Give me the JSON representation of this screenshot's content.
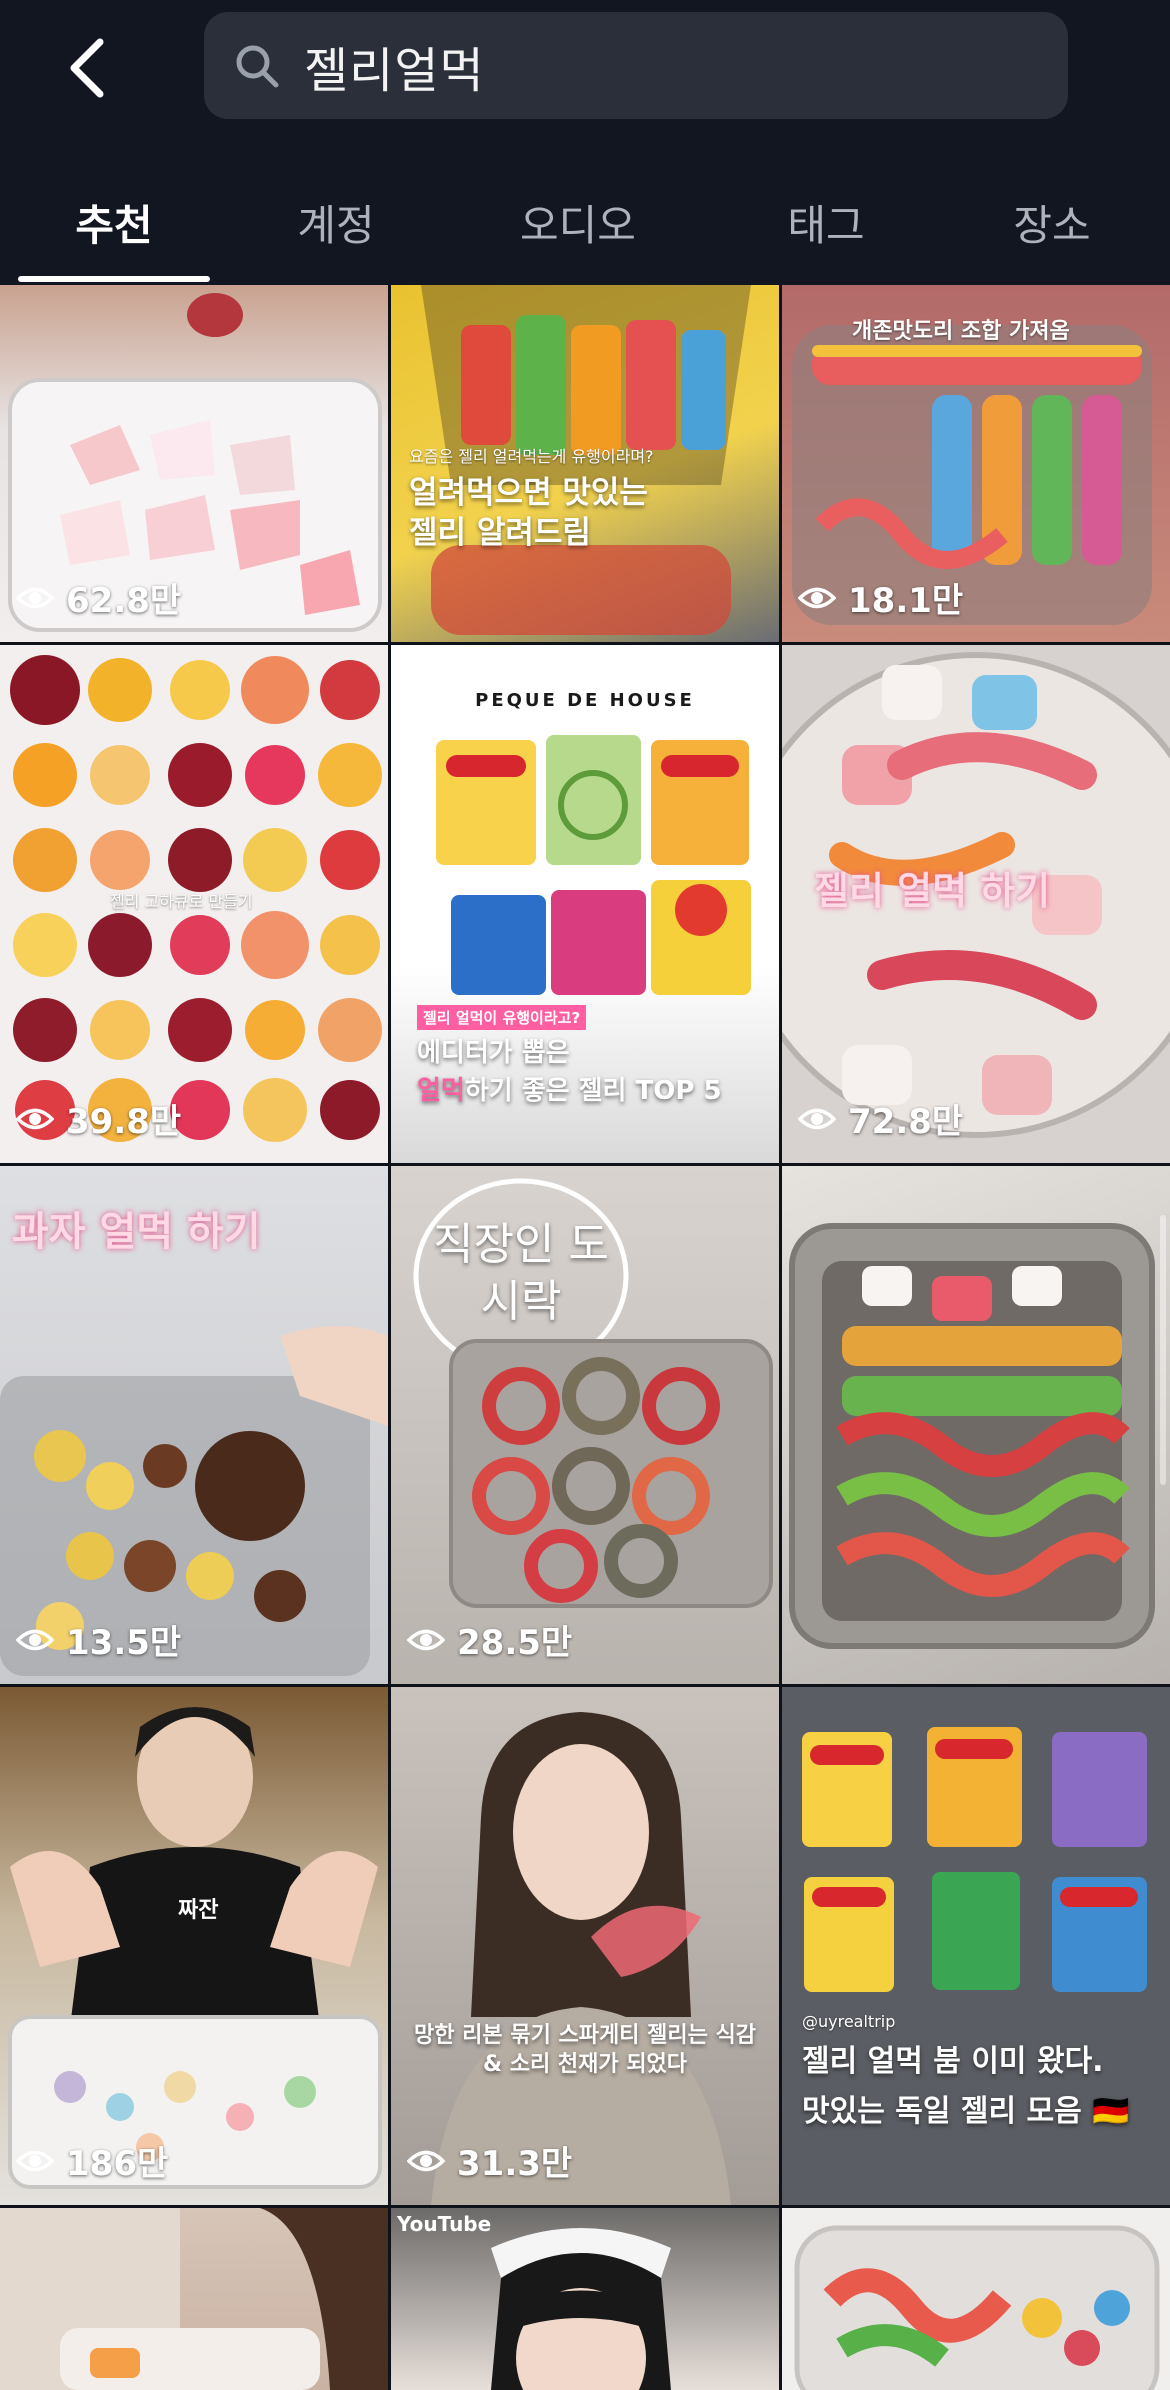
{
  "search": {
    "query": "젤리얼먹"
  },
  "tabs": [
    {
      "label": "추천"
    },
    {
      "label": "계정"
    },
    {
      "label": "오디오"
    },
    {
      "label": "태그"
    },
    {
      "label": "장소"
    }
  ],
  "tiles": [
    {
      "views": "62.8만"
    },
    {
      "caption_small": "요즘은 젤리 얼려먹는게 유행이라며?",
      "caption": "얼려먹으면 맛있는\n젤리 알려드림"
    },
    {
      "caption_small": "개존맛도리 조합 가져옴",
      "views": "18.1만"
    },
    {
      "caption_small": "젤리 고하큐로 만들기",
      "views": "39.8만"
    },
    {
      "brand": "PEQUE DE HOUSE",
      "tag": "젤리 얼먹이 유행이라고?",
      "caption_line1": "에디터가 뽑은",
      "caption_line2_pink": "얼먹",
      "caption_line2_rest": "하기 좋은 젤리 TOP 5"
    },
    {
      "caption": "젤리 얼먹 하기",
      "views": "72.8만"
    },
    {
      "caption": "과자 얼먹 하기",
      "views": "13.5만"
    },
    {
      "caption": "직장인 도시락",
      "views": "28.5만"
    },
    {},
    {
      "shirt_text": "짜잔",
      "views": "186만"
    },
    {
      "caption": "망한 리본 묶기 스파게티 젤리는 식감 & 소리 천재가 되었다",
      "views": "31.3만"
    },
    {
      "handle": "@uyrealtrip",
      "caption": "젤리 얼먹 붐 이미 왔다.\n맛있는 독일 젤리 모음 🇩🇪"
    },
    {},
    {
      "watermark": "YouTube"
    },
    {}
  ],
  "colors": {
    "background": "#0f1219",
    "search_bg": "#2a2f39",
    "tab_inactive": "#aeb2ba",
    "accent_pink": "#ff5fa2"
  }
}
